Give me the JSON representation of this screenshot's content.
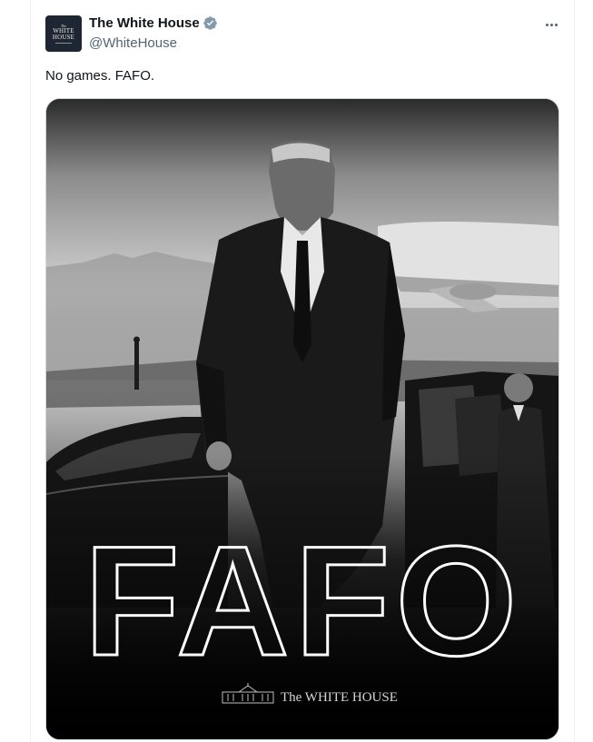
{
  "author": {
    "name": "The White House",
    "handle": "@WhiteHouse",
    "avatar_text": {
      "the": "The",
      "line1": "WHITE",
      "line2": "HOUSE"
    }
  },
  "tweet": {
    "text": "No games. FAFO."
  },
  "media": {
    "headline": "FAFO",
    "logo_text": "The WHITE HOUSE"
  },
  "icons": [
    "verified-badge-icon",
    "more-options-icon",
    "white-house-logo-icon"
  ],
  "colors": {
    "verified": "#829aab",
    "handle": "#536471",
    "text": "#0f1419"
  }
}
